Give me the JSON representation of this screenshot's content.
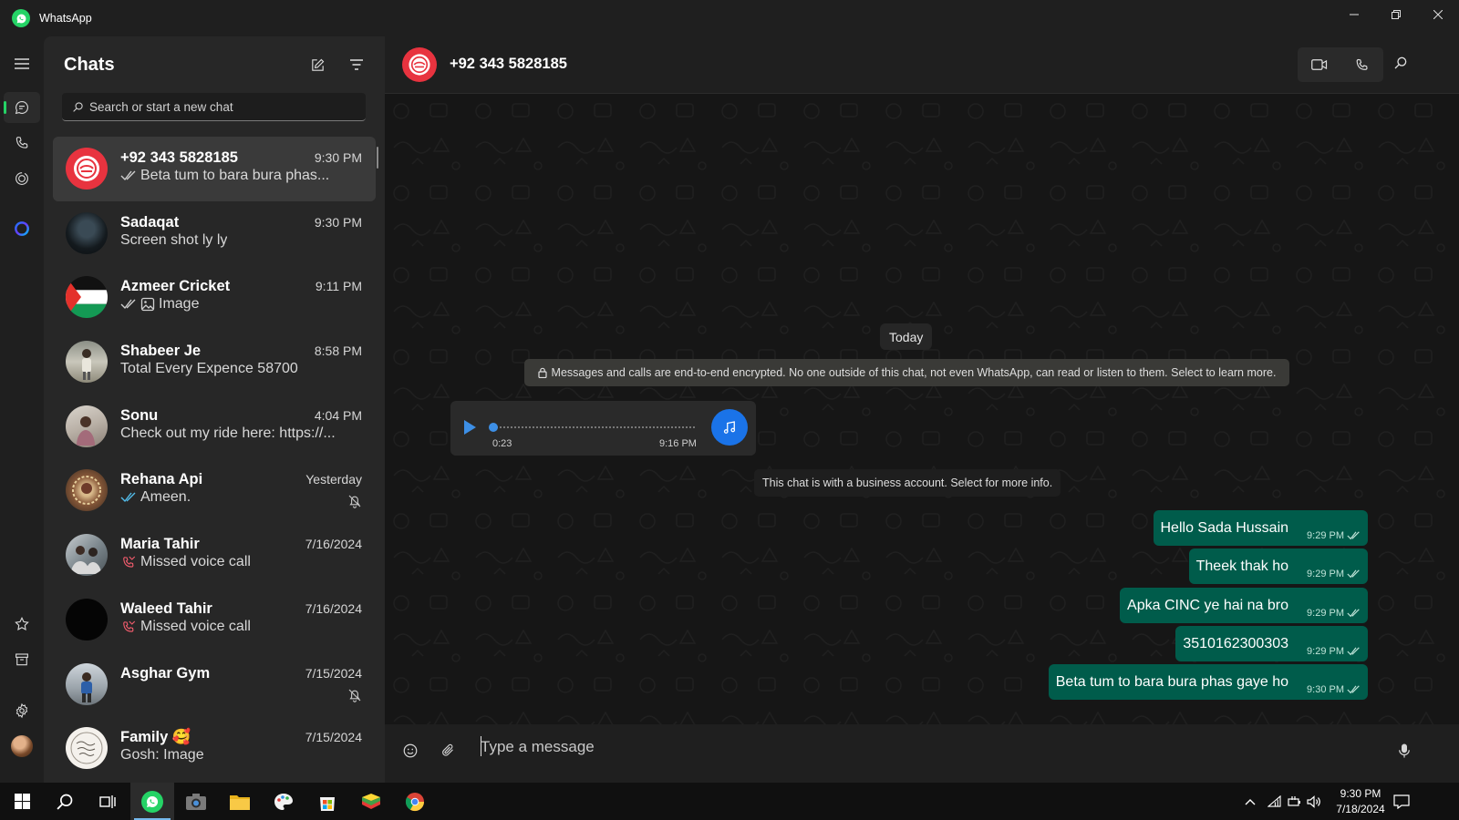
{
  "app": {
    "title": "WhatsApp"
  },
  "sidebar_list": {
    "title": "Chats",
    "search_placeholder": "Search or start a new chat"
  },
  "chats": [
    {
      "name": "+92 343 5828185",
      "time": "9:30 PM",
      "preview": "Beta tum to bara bura phas...",
      "read_ticks": true,
      "selected": true
    },
    {
      "name": "Sadaqat",
      "time": "9:30 PM",
      "preview": "Screen shot ly ly"
    },
    {
      "name": "Azmeer Cricket",
      "time": "9:11 PM",
      "preview": "Image",
      "read_ticks": true,
      "image_icon": true
    },
    {
      "name": "Shabeer Je",
      "time": "8:58 PM",
      "preview": "Total Every Expence 58700"
    },
    {
      "name": "Sonu",
      "time": "4:04 PM",
      "preview": "Check out my ride here: https://..."
    },
    {
      "name": "Rehana Api",
      "time": "Yesterday",
      "preview": "Ameen.",
      "read_ticks": true,
      "read_color": "#53bdeb",
      "muted": true
    },
    {
      "name": "Maria Tahir",
      "time": "7/16/2024",
      "preview": "Missed voice call",
      "missed_call": true
    },
    {
      "name": "Waleed Tahir",
      "time": "7/16/2024",
      "preview": "Missed voice call",
      "missed_call": true
    },
    {
      "name": "Asghar Gym",
      "time": "7/15/2024",
      "preview": "",
      "muted": true
    },
    {
      "name": "Family 🥰",
      "time": "7/15/2024",
      "preview": "Gosh: Image",
      "image_icon": true
    }
  ],
  "conversation": {
    "contact_name": "+92 343 5828185",
    "date_chip": "Today",
    "encryption_notice": "Messages and calls are end-to-end encrypted. No one outside of this chat, not even WhatsApp, can read or listen to them. Select to learn more.",
    "voice_message": {
      "duration": "0:23",
      "time": "9:16 PM"
    },
    "business_notice": "This chat is with a business account. Select for more info.",
    "messages": [
      {
        "text": "Hello Sada Hussain",
        "time": "9:29 PM"
      },
      {
        "text": "Theek thak ho",
        "time": "9:29 PM"
      },
      {
        "text": "Apka CINC ye hai na bro",
        "time": "9:29 PM"
      },
      {
        "text": "3510162300303",
        "time": "9:29 PM"
      },
      {
        "text": "Beta tum to bara bura phas gaye ho",
        "time": "9:30 PM"
      }
    ],
    "composer_placeholder": "Type a message"
  },
  "taskbar": {
    "time": "9:30 PM",
    "date": "7/18/2024"
  },
  "colors": {
    "accent": "#25d366",
    "outgoing_bubble": "#005c4b",
    "read_tick_blue": "#53bdeb",
    "missed_call_red": "#f15c6d"
  }
}
